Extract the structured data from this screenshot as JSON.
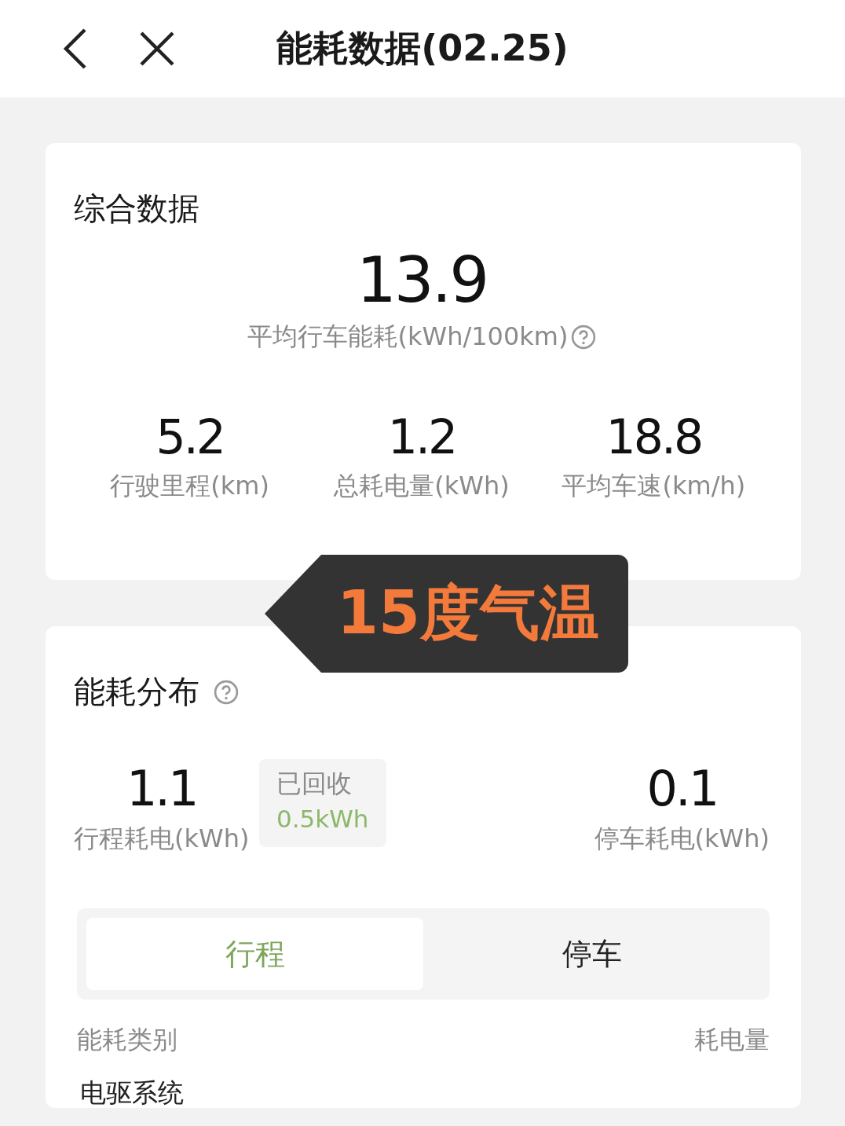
{
  "header": {
    "title": "能耗数据(02.25)"
  },
  "summary": {
    "title": "综合数据",
    "main_value": "13.9",
    "main_label": "平均行车能耗(kWh/100km)",
    "stats": [
      {
        "value": "5.2",
        "label": "行驶里程(km)"
      },
      {
        "value": "1.2",
        "label": "总耗电量(kWh)"
      },
      {
        "value": "18.8",
        "label": "平均车速(km/h)"
      }
    ]
  },
  "callout": {
    "text": "15度气温"
  },
  "distribution": {
    "title": "能耗分布",
    "trip": {
      "value": "1.1",
      "label": "行程耗电(kWh)"
    },
    "recovered": {
      "label": "已回收",
      "value": "0.5kWh"
    },
    "parking": {
      "value": "0.1",
      "label": "停车耗电(kWh)"
    },
    "tabs": [
      {
        "label": "行程",
        "selected": true
      },
      {
        "label": "停车",
        "selected": false
      }
    ],
    "columns": [
      "能耗类别",
      "耗电量"
    ],
    "rows": [
      {
        "category": "电驱系统"
      }
    ]
  }
}
